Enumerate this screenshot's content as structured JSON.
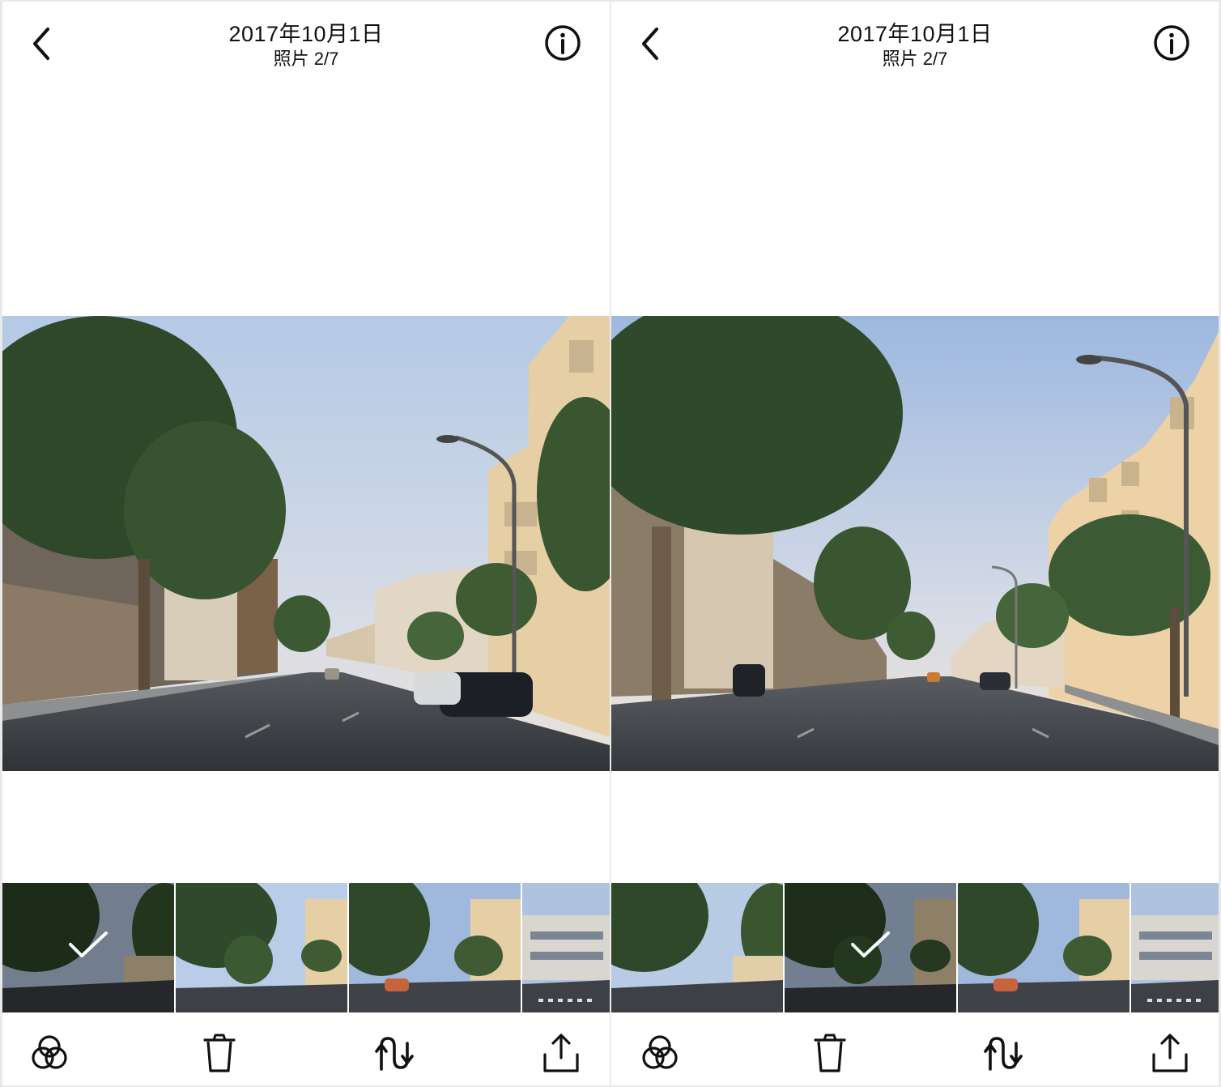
{
  "screens": [
    {
      "header": {
        "date": "2017年10月1日",
        "count": "照片 2/7"
      },
      "photo": {
        "scene": "street-view-left-angle"
      },
      "filmstrip": {
        "selected_index": 0,
        "thumb_count": 4
      },
      "toolbar": {
        "icons": [
          "filters-icon",
          "trash-icon",
          "loop-icon",
          "share-icon"
        ]
      }
    },
    {
      "header": {
        "date": "2017年10月1日",
        "count": "照片 2/7"
      },
      "photo": {
        "scene": "street-view-right-angle"
      },
      "filmstrip": {
        "selected_index": 1,
        "thumb_count": 4
      },
      "toolbar": {
        "icons": [
          "filters-icon",
          "trash-icon",
          "loop-icon",
          "share-icon"
        ]
      }
    }
  ],
  "colors": {
    "sky_top": "#b9cde8",
    "sky_bottom": "#e9e6e4",
    "tree": "#2f4a2b",
    "road": "#3d4045",
    "building": "#e8d4b0"
  }
}
